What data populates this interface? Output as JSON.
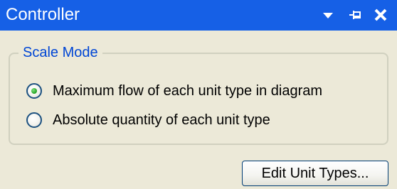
{
  "window": {
    "title": "Controller",
    "title_bg": "#1660e6",
    "panel_bg": "#ece9d8"
  },
  "titlebar_buttons": [
    {
      "icon": "dropdown-arrow-icon"
    },
    {
      "icon": "pin-icon"
    },
    {
      "icon": "close-icon"
    }
  ],
  "scale_mode": {
    "legend": "Scale Mode",
    "legend_color": "#0046d5",
    "options": [
      {
        "label": "Maximum flow of each unit type in diagram",
        "selected": true
      },
      {
        "label": "Absolute quantity of each unit type",
        "selected": false
      }
    ]
  },
  "buttons": {
    "edit_unit_types": "Edit Unit Types..."
  }
}
